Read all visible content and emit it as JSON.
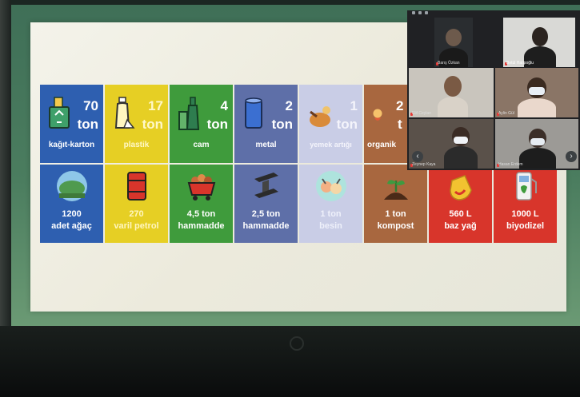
{
  "colors": {
    "paper": "#2e5fb0",
    "plastic": "#e6cf24",
    "glass": "#3f9b3c",
    "metal": "#5e6fa8",
    "food": "#c9cde6",
    "organic": "#a8673f",
    "oil": "#d8352b",
    "call_bg": "#202124"
  },
  "infographic": {
    "top_row": [
      {
        "amount": "70",
        "unit": "ton",
        "caption": "kağıt-karton",
        "icon": "recycle-box-icon"
      },
      {
        "amount": "17",
        "unit": "ton",
        "caption": "plastik",
        "icon": "plastic-bottle-icon"
      },
      {
        "amount": "4",
        "unit": "ton",
        "caption": "cam",
        "icon": "glass-bottle-icon"
      },
      {
        "amount": "2",
        "unit": "ton",
        "caption": "metal",
        "icon": "metal-can-icon"
      },
      {
        "amount": "1",
        "unit": "ton",
        "caption": "yemek artığı",
        "icon": "food-waste-icon"
      },
      {
        "amount": "2",
        "unit": "t",
        "caption": "organik",
        "icon": "organic-waste-icon"
      }
    ],
    "bottom_row": [
      {
        "line1": "1200",
        "line2": "adet ağaç",
        "icon": "tree-icon"
      },
      {
        "line1": "270",
        "line2": "varil petrol",
        "icon": "oil-barrel-icon"
      },
      {
        "line1": "4,5 ton",
        "line2": "hammadde",
        "icon": "mine-cart-icon"
      },
      {
        "line1": "2,5 ton",
        "line2": "hammadde",
        "icon": "steel-beam-icon"
      },
      {
        "line1": "1 ton",
        "line2": "besin",
        "icon": "animals-icon"
      },
      {
        "line1": "1 ton",
        "line2": "kompost",
        "icon": "sprout-icon"
      },
      {
        "line1": "560 L",
        "line2": "baz yağ",
        "icon": "oil-drop-icon"
      },
      {
        "line1": "1000 L",
        "line2": "biyodizel",
        "icon": "fuel-pump-icon"
      }
    ]
  },
  "call": {
    "participants": [
      {
        "name": "Barış Özkan"
      },
      {
        "name": "Betül Hatipoğlu"
      },
      {
        "name": "Elif Ceylan"
      },
      {
        "name": "Aylin Gül"
      },
      {
        "name": "Zeynep Kaya"
      },
      {
        "name": "Hasan Erdem"
      }
    ],
    "prev_arrow": "‹",
    "next_arrow": "›"
  }
}
